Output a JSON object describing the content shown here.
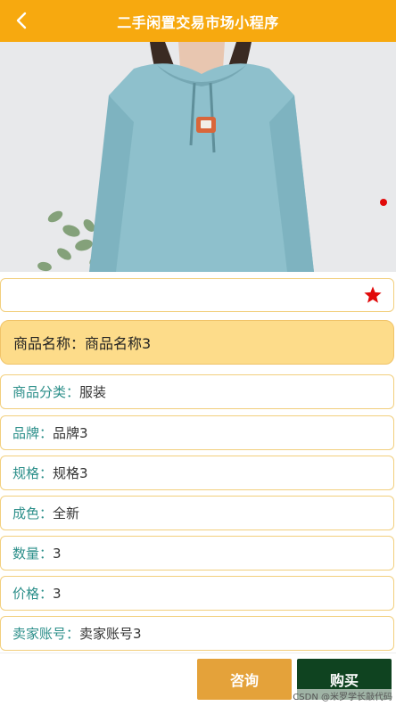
{
  "header": {
    "title": "二手闲置交易市场小程序",
    "back_icon": "chevron-left-icon",
    "color": "#f7a90f"
  },
  "gallery": {
    "image": "product-photo",
    "indicator_color": "#e10a0a"
  },
  "favorite": {
    "icon": "star-icon",
    "color": "#e10a0a"
  },
  "product": {
    "name_label": "商品名称：",
    "name_value": "商品名称3"
  },
  "details": [
    {
      "label": "商品分类：",
      "value": "服装"
    },
    {
      "label": "品牌：",
      "value": "品牌3"
    },
    {
      "label": "规格：",
      "value": "规格3"
    },
    {
      "label": "成色：",
      "value": "全新"
    },
    {
      "label": "数量：",
      "value": "3"
    },
    {
      "label": "价格：",
      "value": "3"
    },
    {
      "label": "卖家账号：",
      "value": "卖家账号3"
    }
  ],
  "actions": {
    "consult_label": "咨询",
    "buy_label": "购买"
  },
  "watermark": "CSDN @米罗学长敲代码"
}
